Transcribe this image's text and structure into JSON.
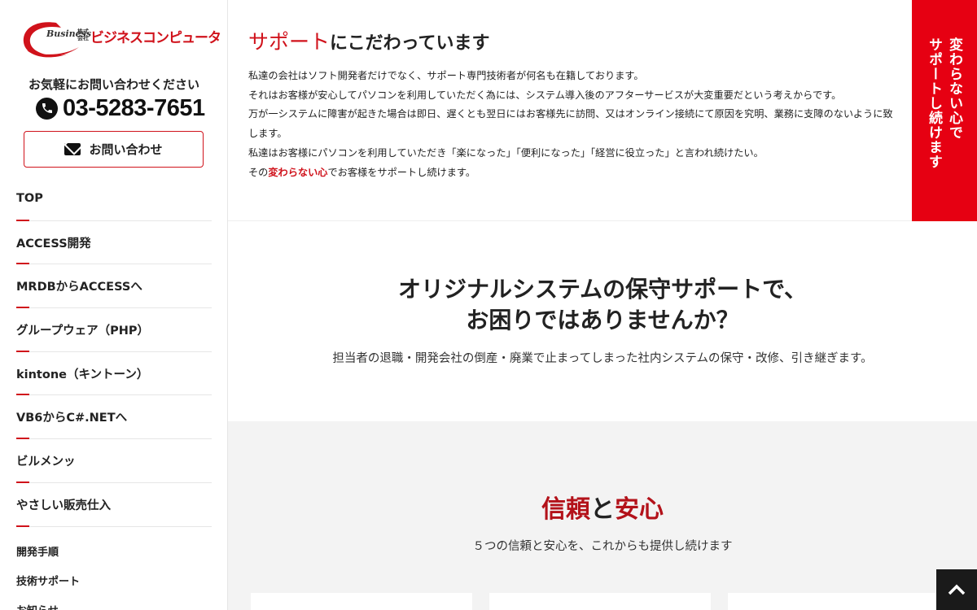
{
  "brand": {
    "logo_business": "Business",
    "logo_kabushiki": "株式会社",
    "logo_name": "ビジネスコンピュータ",
    "accent_color": "#d0121b",
    "banner_color": "#e60012"
  },
  "sidebar": {
    "contact_label": "お気軽にお問い合わせください",
    "phone_icon": "phone-icon",
    "phone": "03-5283-7651",
    "contact_button": "お問い合わせ",
    "mail_icon": "mail-icon",
    "nav_items": [
      {
        "label": "TOP"
      },
      {
        "label": "ACCESS開発"
      },
      {
        "label": "MRDBからACCESSへ"
      },
      {
        "label": "グループウェア（PHP）"
      },
      {
        "label": "kintone（キントーン）"
      },
      {
        "label": "VB6からC#.NETへ"
      },
      {
        "label": "ビルメンッ"
      },
      {
        "label": "やさしい販売仕入"
      }
    ],
    "sub_items": [
      {
        "label": "開発手順"
      },
      {
        "label": "技術サポート"
      },
      {
        "label": "お知らせ"
      }
    ]
  },
  "intro": {
    "title_accent": "サポート",
    "title_rest": "にこだわっています",
    "lines": [
      "私達の会社はソフト開発者だけでなく、サポート専門技術者が何名も在籍しております。",
      "それはお客様が安心してパソコンを利用していただく為には、システム導入後のアフターサービスが大変重要だという考えからです。",
      "万が一システムに障害が起きた場合は即日、遅くとも翌日にはお客様先に訪問、又はオンライン接続にて原因を究明、業務に支障のないように致します。",
      "私達はお客様にパソコンを利用していただき「楽になった」「便利になった」「経営に役立った」と言われ続けたい。"
    ],
    "last_prefix": "その",
    "last_emphasis": "変わらない心",
    "last_suffix": "でお客様をサポートし続けます。"
  },
  "banner": {
    "line1": "変わらない心で",
    "line2": "サポートし続けます"
  },
  "question": {
    "title_line1": "オリジナルシステムの保守サポートで、",
    "title_line2": "お困りではありませんか？",
    "subtitle": "担当者の退職・開発会社の倒産・廃業で止まってしまった社内システムの保守・改修、引き継ぎます。"
  },
  "trust": {
    "title_word1": "信頼",
    "title_mid": "と",
    "title_word2": "安心",
    "subtitle": "５つの信頼と安心を、これからも提供し続けます"
  },
  "back_to_top_icon": "chevron-up-icon"
}
